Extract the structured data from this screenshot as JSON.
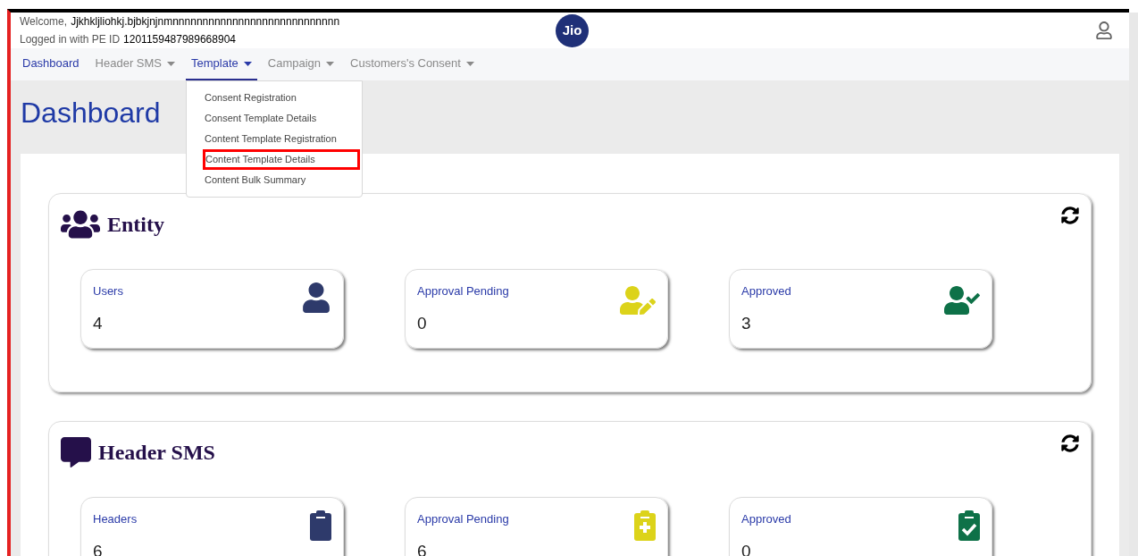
{
  "header": {
    "welcome_label": "Welcome,",
    "user_name": "Jjkhkljliohkj.bjbkjnjnmnnnnnnnnnnnnnnnnnnnnnnnnnnnn",
    "pe_label": "Logged in with PE ID",
    "pe_id": "1201159487989668904",
    "logo_text": "Jio"
  },
  "nav": [
    {
      "label": "Dashboard",
      "kind": "link",
      "current": true,
      "selected": false
    },
    {
      "label": "Header SMS",
      "kind": "dropdown",
      "current": false,
      "selected": false
    },
    {
      "label": "Template",
      "kind": "dropdown",
      "current": false,
      "selected": true,
      "menu": [
        {
          "label": "Consent Registration",
          "highlighted": false
        },
        {
          "label": "Consent Template Details",
          "highlighted": false
        },
        {
          "label": "Content Template Registration",
          "highlighted": false
        },
        {
          "label": "Content Template Details",
          "highlighted": true
        },
        {
          "label": "Content Bulk Summary",
          "highlighted": false
        }
      ]
    },
    {
      "label": "Campaign",
      "kind": "dropdown",
      "current": false,
      "selected": false
    },
    {
      "label": "Customers's Consent",
      "kind": "dropdown",
      "current": false,
      "selected": false
    }
  ],
  "page_title": "Dashboard",
  "sections": [
    {
      "title": "Entity",
      "kind": "users",
      "cards": [
        {
          "label": "Users",
          "value": "4",
          "kind": "user",
          "color": "#2e3a6b"
        },
        {
          "label": "Approval Pending",
          "value": "0",
          "kind": "user-edit",
          "color": "#dcd31a"
        },
        {
          "label": "Approved",
          "value": "3",
          "kind": "user-check",
          "color": "#0e7148"
        }
      ]
    },
    {
      "title": "Header SMS",
      "kind": "message",
      "cards": [
        {
          "label": "Headers",
          "value": "6",
          "kind": "clipboard",
          "color": "#2e3a6b"
        },
        {
          "label": "Approval Pending",
          "value": "6",
          "kind": "clipboard-plus",
          "color": "#dcd31a"
        },
        {
          "label": "Approved",
          "value": "0",
          "kind": "clipboard-check",
          "color": "#0e7148"
        }
      ]
    }
  ]
}
